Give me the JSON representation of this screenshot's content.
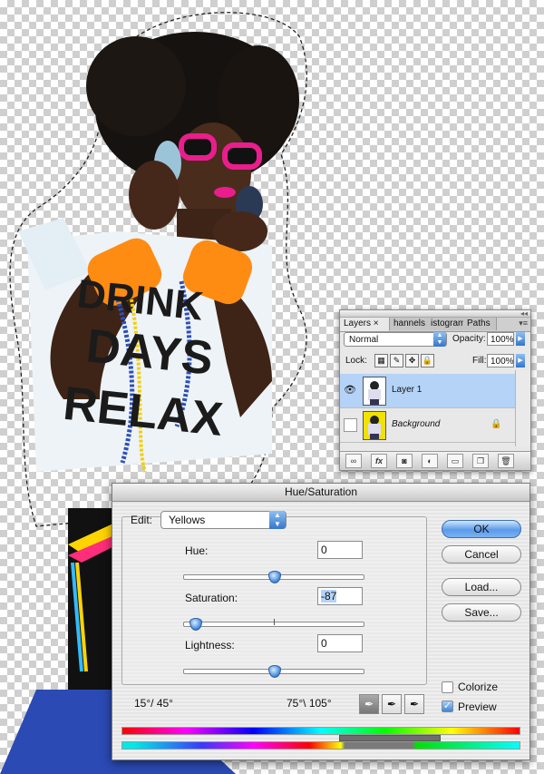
{
  "layers_panel": {
    "tabs": [
      "Layers",
      "hannels",
      "istogram",
      "Paths"
    ],
    "blend_mode": "Normal",
    "opacity_label": "Opacity:",
    "opacity_value": "100%",
    "lock_label": "Lock:",
    "fill_label": "Fill:",
    "fill_value": "100%",
    "layers": [
      {
        "name": "Layer 1",
        "visible": true,
        "selected": true
      },
      {
        "name": "Background",
        "visible": false,
        "selected": false,
        "locked": true
      }
    ],
    "footer_icons": [
      "link-icon",
      "fx-icon",
      "mask-icon",
      "adjustment-icon",
      "group-icon",
      "new-layer-icon",
      "trash-icon"
    ]
  },
  "dialog": {
    "title": "Hue/Saturation",
    "edit_label": "Edit:",
    "edit_value": "Yellows",
    "hue": {
      "label": "Hue:",
      "value": "0"
    },
    "saturation": {
      "label": "Saturation:",
      "value": "-87"
    },
    "lightness": {
      "label": "Lightness:",
      "value": "0"
    },
    "range_left": "15°/ 45°",
    "range_right": "75°\\ 105°",
    "buttons": {
      "ok": "OK",
      "cancel": "Cancel",
      "load": "Load...",
      "save": "Save..."
    },
    "colorize": {
      "label": "Colorize",
      "checked": false
    },
    "preview": {
      "label": "Preview",
      "checked": true
    }
  },
  "colors": {
    "accent": "#3c83d8",
    "selection": "#b5d3f7"
  },
  "canvas": {
    "shirt_text": [
      "DRINK",
      "DAYS",
      "RELAX"
    ]
  }
}
